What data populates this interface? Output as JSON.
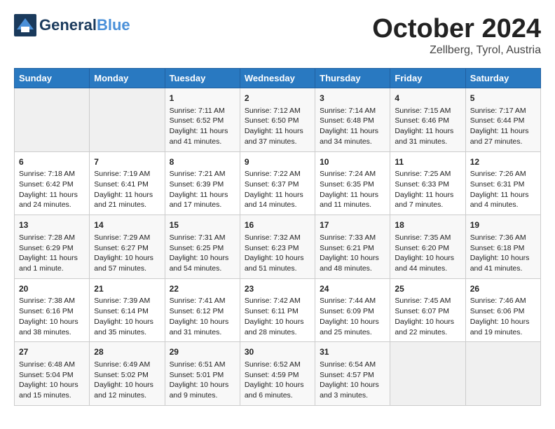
{
  "header": {
    "logo_general": "General",
    "logo_blue": "Blue",
    "month": "October 2024",
    "location": "Zellberg, Tyrol, Austria"
  },
  "weekdays": [
    "Sunday",
    "Monday",
    "Tuesday",
    "Wednesday",
    "Thursday",
    "Friday",
    "Saturday"
  ],
  "weeks": [
    [
      {
        "day": "",
        "sunrise": "",
        "sunset": "",
        "daylight": ""
      },
      {
        "day": "",
        "sunrise": "",
        "sunset": "",
        "daylight": ""
      },
      {
        "day": "1",
        "sunrise": "Sunrise: 7:11 AM",
        "sunset": "Sunset: 6:52 PM",
        "daylight": "Daylight: 11 hours and 41 minutes."
      },
      {
        "day": "2",
        "sunrise": "Sunrise: 7:12 AM",
        "sunset": "Sunset: 6:50 PM",
        "daylight": "Daylight: 11 hours and 37 minutes."
      },
      {
        "day": "3",
        "sunrise": "Sunrise: 7:14 AM",
        "sunset": "Sunset: 6:48 PM",
        "daylight": "Daylight: 11 hours and 34 minutes."
      },
      {
        "day": "4",
        "sunrise": "Sunrise: 7:15 AM",
        "sunset": "Sunset: 6:46 PM",
        "daylight": "Daylight: 11 hours and 31 minutes."
      },
      {
        "day": "5",
        "sunrise": "Sunrise: 7:17 AM",
        "sunset": "Sunset: 6:44 PM",
        "daylight": "Daylight: 11 hours and 27 minutes."
      }
    ],
    [
      {
        "day": "6",
        "sunrise": "Sunrise: 7:18 AM",
        "sunset": "Sunset: 6:42 PM",
        "daylight": "Daylight: 11 hours and 24 minutes."
      },
      {
        "day": "7",
        "sunrise": "Sunrise: 7:19 AM",
        "sunset": "Sunset: 6:41 PM",
        "daylight": "Daylight: 11 hours and 21 minutes."
      },
      {
        "day": "8",
        "sunrise": "Sunrise: 7:21 AM",
        "sunset": "Sunset: 6:39 PM",
        "daylight": "Daylight: 11 hours and 17 minutes."
      },
      {
        "day": "9",
        "sunrise": "Sunrise: 7:22 AM",
        "sunset": "Sunset: 6:37 PM",
        "daylight": "Daylight: 11 hours and 14 minutes."
      },
      {
        "day": "10",
        "sunrise": "Sunrise: 7:24 AM",
        "sunset": "Sunset: 6:35 PM",
        "daylight": "Daylight: 11 hours and 11 minutes."
      },
      {
        "day": "11",
        "sunrise": "Sunrise: 7:25 AM",
        "sunset": "Sunset: 6:33 PM",
        "daylight": "Daylight: 11 hours and 7 minutes."
      },
      {
        "day": "12",
        "sunrise": "Sunrise: 7:26 AM",
        "sunset": "Sunset: 6:31 PM",
        "daylight": "Daylight: 11 hours and 4 minutes."
      }
    ],
    [
      {
        "day": "13",
        "sunrise": "Sunrise: 7:28 AM",
        "sunset": "Sunset: 6:29 PM",
        "daylight": "Daylight: 11 hours and 1 minute."
      },
      {
        "day": "14",
        "sunrise": "Sunrise: 7:29 AM",
        "sunset": "Sunset: 6:27 PM",
        "daylight": "Daylight: 10 hours and 57 minutes."
      },
      {
        "day": "15",
        "sunrise": "Sunrise: 7:31 AM",
        "sunset": "Sunset: 6:25 PM",
        "daylight": "Daylight: 10 hours and 54 minutes."
      },
      {
        "day": "16",
        "sunrise": "Sunrise: 7:32 AM",
        "sunset": "Sunset: 6:23 PM",
        "daylight": "Daylight: 10 hours and 51 minutes."
      },
      {
        "day": "17",
        "sunrise": "Sunrise: 7:33 AM",
        "sunset": "Sunset: 6:21 PM",
        "daylight": "Daylight: 10 hours and 48 minutes."
      },
      {
        "day": "18",
        "sunrise": "Sunrise: 7:35 AM",
        "sunset": "Sunset: 6:20 PM",
        "daylight": "Daylight: 10 hours and 44 minutes."
      },
      {
        "day": "19",
        "sunrise": "Sunrise: 7:36 AM",
        "sunset": "Sunset: 6:18 PM",
        "daylight": "Daylight: 10 hours and 41 minutes."
      }
    ],
    [
      {
        "day": "20",
        "sunrise": "Sunrise: 7:38 AM",
        "sunset": "Sunset: 6:16 PM",
        "daylight": "Daylight: 10 hours and 38 minutes."
      },
      {
        "day": "21",
        "sunrise": "Sunrise: 7:39 AM",
        "sunset": "Sunset: 6:14 PM",
        "daylight": "Daylight: 10 hours and 35 minutes."
      },
      {
        "day": "22",
        "sunrise": "Sunrise: 7:41 AM",
        "sunset": "Sunset: 6:12 PM",
        "daylight": "Daylight: 10 hours and 31 minutes."
      },
      {
        "day": "23",
        "sunrise": "Sunrise: 7:42 AM",
        "sunset": "Sunset: 6:11 PM",
        "daylight": "Daylight: 10 hours and 28 minutes."
      },
      {
        "day": "24",
        "sunrise": "Sunrise: 7:44 AM",
        "sunset": "Sunset: 6:09 PM",
        "daylight": "Daylight: 10 hours and 25 minutes."
      },
      {
        "day": "25",
        "sunrise": "Sunrise: 7:45 AM",
        "sunset": "Sunset: 6:07 PM",
        "daylight": "Daylight: 10 hours and 22 minutes."
      },
      {
        "day": "26",
        "sunrise": "Sunrise: 7:46 AM",
        "sunset": "Sunset: 6:06 PM",
        "daylight": "Daylight: 10 hours and 19 minutes."
      }
    ],
    [
      {
        "day": "27",
        "sunrise": "Sunrise: 6:48 AM",
        "sunset": "Sunset: 5:04 PM",
        "daylight": "Daylight: 10 hours and 15 minutes."
      },
      {
        "day": "28",
        "sunrise": "Sunrise: 6:49 AM",
        "sunset": "Sunset: 5:02 PM",
        "daylight": "Daylight: 10 hours and 12 minutes."
      },
      {
        "day": "29",
        "sunrise": "Sunrise: 6:51 AM",
        "sunset": "Sunset: 5:01 PM",
        "daylight": "Daylight: 10 hours and 9 minutes."
      },
      {
        "day": "30",
        "sunrise": "Sunrise: 6:52 AM",
        "sunset": "Sunset: 4:59 PM",
        "daylight": "Daylight: 10 hours and 6 minutes."
      },
      {
        "day": "31",
        "sunrise": "Sunrise: 6:54 AM",
        "sunset": "Sunset: 4:57 PM",
        "daylight": "Daylight: 10 hours and 3 minutes."
      },
      {
        "day": "",
        "sunrise": "",
        "sunset": "",
        "daylight": ""
      },
      {
        "day": "",
        "sunrise": "",
        "sunset": "",
        "daylight": ""
      }
    ]
  ]
}
